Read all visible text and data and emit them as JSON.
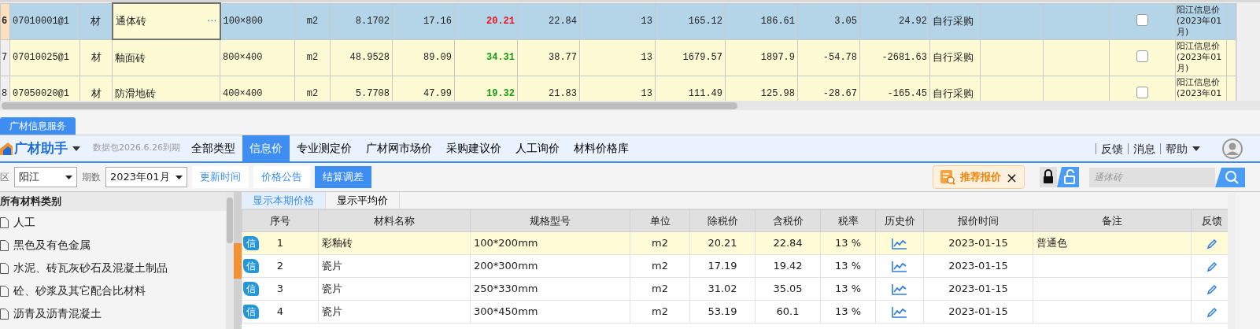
{
  "top_grid": {
    "rows": [
      {
        "row_number": "6",
        "selected": true,
        "code": "07010001@1",
        "type": "材",
        "name": "通体砖",
        "editing": true,
        "editor_button": "···",
        "spec": "100×800",
        "unit": "m2",
        "values": [
          "8.1702",
          "17.16",
          "20.21",
          "22.84",
          "13",
          "165.12",
          "186.61",
          "3.05",
          "24.92"
        ],
        "color": "#e8141e",
        "source": "自行采购",
        "checked": false,
        "price_source": "阳江信息价(2023年01月)"
      },
      {
        "row_number": "7",
        "selected": false,
        "code": "07010025@1",
        "type": "材",
        "name": "釉面砖",
        "editing": false,
        "spec": "800×400",
        "unit": "m2",
        "values": [
          "48.9528",
          "89.09",
          "34.31",
          "38.77",
          "13",
          "1679.57",
          "1897.9",
          "-54.78",
          "-2681.63"
        ],
        "color": "#1a9a1a",
        "source": "自行采购",
        "checked": false,
        "price_source": "阳江信息价(2023年01月)"
      },
      {
        "row_number": "8",
        "selected": false,
        "code": "07050020@1",
        "type": "材",
        "name": "防滑地砖",
        "editing": false,
        "spec": "400×400",
        "unit": "m2",
        "values": [
          "5.7708",
          "47.99",
          "19.32",
          "21.83",
          "13",
          "111.49",
          "125.98",
          "-28.67",
          "-165.45"
        ],
        "color": "#1a9a1a",
        "source": "自行采购",
        "checked": false,
        "price_source": "阳江信息价(2023年01"
      }
    ]
  },
  "panel_tab": "广材信息服务",
  "toolbar": {
    "logo": "广材助手",
    "package_note": "数据包2026.6.26到期",
    "tabs": [
      {
        "label": "全部类型",
        "selected": false
      },
      {
        "label": "信息价",
        "selected": true
      },
      {
        "label": "专业测定价",
        "selected": false
      },
      {
        "label": "广材网市场价",
        "selected": false
      },
      {
        "label": "采购建议价",
        "selected": false
      },
      {
        "label": "人工询价",
        "selected": false
      },
      {
        "label": "材料价格库",
        "selected": false
      }
    ],
    "links": [
      "反馈",
      "消息",
      "帮助"
    ]
  },
  "filters": {
    "region_label": "区",
    "region": "阳江",
    "period_label": "期数",
    "period": "2023年01月",
    "buttons": [
      {
        "label": "更新时间",
        "selected": false
      },
      {
        "label": "价格公告",
        "selected": false
      },
      {
        "label": "结算调差",
        "selected": true
      }
    ],
    "recommend": "推荐报价",
    "recommend_close": "×",
    "search": {
      "placeholder": "通体砖"
    }
  },
  "categories": {
    "title": "所有材料类别",
    "items": [
      "人工",
      "黑色及有色金属",
      "水泥、砖瓦灰砂石及混凝土制品",
      "砼、砂浆及其它配合比材料",
      "沥青及沥青混凝土"
    ]
  },
  "price_tabs": [
    {
      "label": "显示本期价格",
      "selected": true
    },
    {
      "label": "显示平均价",
      "selected": false
    }
  ],
  "price_table": {
    "columns": [
      "序号",
      "材料名称",
      "规格型号",
      "单位",
      "除税价",
      "含税价",
      "税率",
      "历史价",
      "报价时间",
      "备注",
      "反馈"
    ],
    "rows": [
      {
        "badge": "信",
        "number": "1",
        "name": "彩釉砖",
        "spec": "100*200mm",
        "unit": "m2",
        "price_ex_tax": "20.21",
        "price_inc_tax": "22.84",
        "tax_rate": "13 %",
        "quote_date": "2023-01-15",
        "remark": "普通色",
        "selected": true
      },
      {
        "badge": "信",
        "number": "2",
        "name": "瓷片",
        "spec": "200*300mm",
        "unit": "m2",
        "price_ex_tax": "17.19",
        "price_inc_tax": "19.42",
        "tax_rate": "13 %",
        "quote_date": "2023-01-15",
        "selected": false
      },
      {
        "badge": "信",
        "number": "3",
        "name": "瓷片",
        "spec": "250*330mm",
        "unit": "m2",
        "price_ex_tax": "31.02",
        "price_inc_tax": "35.05",
        "tax_rate": "13 %",
        "quote_date": "2023-01-15",
        "selected": false
      },
      {
        "badge": "信",
        "number": "4",
        "name": "瓷片",
        "spec": "300*450mm",
        "unit": "m2",
        "price_ex_tax": "53.19",
        "price_inc_tax": "60.1",
        "tax_rate": "13 %",
        "quote_date": "2023-01-15",
        "selected": false
      }
    ]
  }
}
